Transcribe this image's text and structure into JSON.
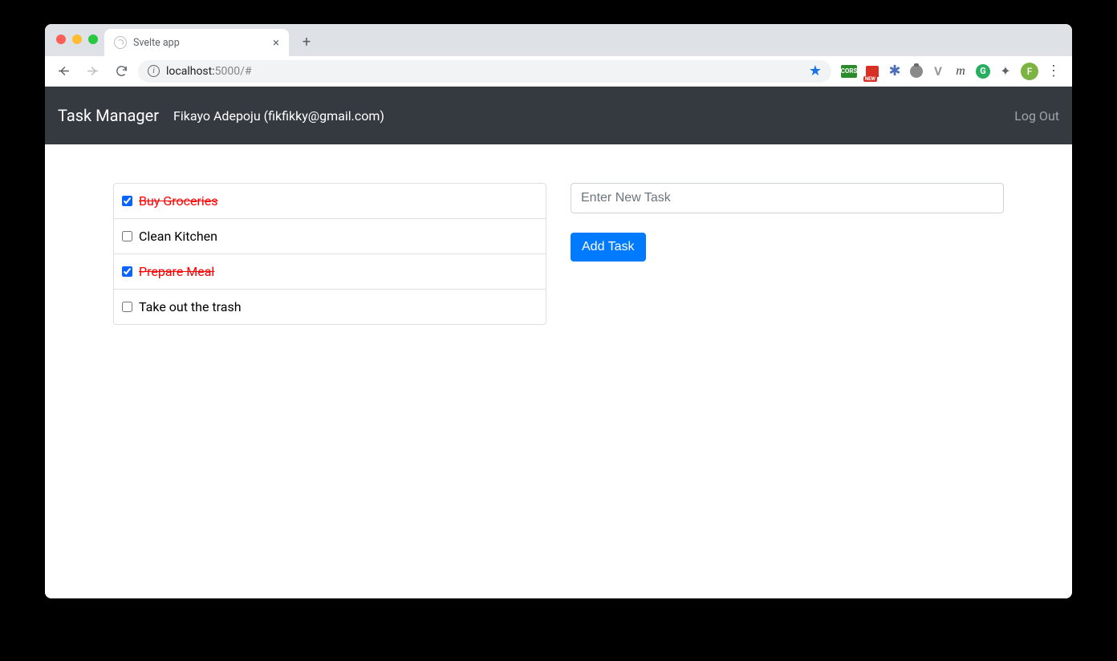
{
  "browser": {
    "tab_title": "Svelte app",
    "url_host": "localhost:",
    "url_port_path": "5000/#",
    "avatar_initial": "F",
    "cors_label": "CORS",
    "new_label": "NEW",
    "g_label": "G"
  },
  "app": {
    "brand": "Task Manager",
    "user_display": "Fikayo Adepoju (fikfikky@gmail.com)",
    "logout_label": "Log Out",
    "tasks": [
      {
        "label": "Buy Groceries",
        "completed": true
      },
      {
        "label": "Clean Kitchen",
        "completed": false
      },
      {
        "label": "Prepare Meal",
        "completed": true
      },
      {
        "label": "Take out the trash",
        "completed": false
      }
    ],
    "new_task_placeholder": "Enter New Task",
    "add_task_label": "Add Task"
  }
}
